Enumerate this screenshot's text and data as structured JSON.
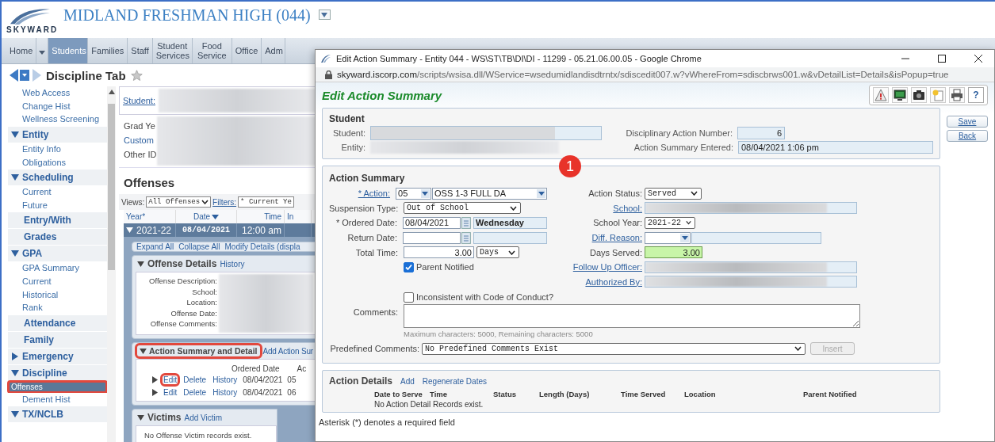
{
  "app": {
    "logo": "SKYWARD",
    "school": "MIDLAND FRESHMAN HIGH (044)"
  },
  "nav": [
    {
      "label": "Home",
      "selected": false,
      "menu": true
    },
    {
      "label": "Students",
      "selected": true,
      "menu": false
    },
    {
      "label": "Families",
      "selected": false,
      "menu": false
    },
    {
      "label": "Staff",
      "selected": false,
      "menu": false
    },
    {
      "label": "Student Services",
      "selected": false,
      "menu": false
    },
    {
      "label": "Food Service",
      "selected": false,
      "menu": false
    },
    {
      "label": "Office",
      "selected": false,
      "menu": false
    },
    {
      "label": "Adm",
      "selected": false,
      "menu": false
    }
  ],
  "breadcrumb": {
    "title": "Discipline Tab"
  },
  "sidebar": [
    {
      "kind": "link",
      "label": "Web Access",
      "selected": false,
      "highlighted": false
    },
    {
      "kind": "link",
      "label": "Change Hist",
      "selected": false,
      "highlighted": false
    },
    {
      "kind": "link",
      "label": "Wellness Screening",
      "selected": false,
      "highlighted": false
    },
    {
      "kind": "section",
      "label": "Entity",
      "expanded": true,
      "children": [
        {
          "kind": "link",
          "label": "Entity Info",
          "selected": false,
          "highlighted": false
        },
        {
          "kind": "link",
          "label": "Obligations",
          "selected": false,
          "highlighted": false
        }
      ]
    },
    {
      "kind": "section",
      "label": "Scheduling",
      "expanded": true,
      "children": [
        {
          "kind": "link",
          "label": "Current",
          "selected": false,
          "highlighted": false
        },
        {
          "kind": "link",
          "label": "Future",
          "selected": false,
          "highlighted": false
        }
      ]
    },
    {
      "kind": "heading",
      "label": "Entry/With"
    },
    {
      "kind": "heading",
      "label": "Grades"
    },
    {
      "kind": "section",
      "label": "GPA",
      "expanded": true,
      "children": [
        {
          "kind": "link",
          "label": "GPA Summary",
          "selected": false,
          "highlighted": false
        },
        {
          "kind": "link",
          "label": "Current",
          "selected": false,
          "highlighted": false
        },
        {
          "kind": "link",
          "label": "Historical",
          "selected": false,
          "highlighted": false
        },
        {
          "kind": "link",
          "label": "Rank",
          "selected": false,
          "highlighted": false
        }
      ]
    },
    {
      "kind": "heading",
      "label": "Attendance"
    },
    {
      "kind": "heading",
      "label": "Family"
    },
    {
      "kind": "section",
      "label": "Emergency",
      "expanded": false
    },
    {
      "kind": "section",
      "label": "Discipline",
      "expanded": true,
      "children": [
        {
          "kind": "link",
          "label": "Offenses",
          "selected": true,
          "highlighted": true
        },
        {
          "kind": "link",
          "label": "Dement Hist",
          "selected": false,
          "highlighted": false
        }
      ]
    },
    {
      "kind": "section",
      "label": "TX/NCLB",
      "expanded": true
    }
  ],
  "student_header": {
    "student_label": "Student:",
    "labels": [
      {
        "text": "Grad Ye",
        "link": false
      },
      {
        "text": "Custom",
        "link": true
      },
      {
        "text": "Other ID",
        "link": false
      }
    ]
  },
  "offenses": {
    "title": "Offenses",
    "views_label": "Views:",
    "view": "All Offenses",
    "filters_label": "Filters:",
    "filter": "* Current Ye",
    "columns": [
      {
        "label": "Year*",
        "sort": false
      },
      {
        "label": "Date",
        "sort": true
      },
      {
        "label": "Time",
        "sort": false
      },
      {
        "label": "In",
        "sort": false
      }
    ],
    "row": {
      "year": "2021-22",
      "date": "08/04/2021",
      "time": "12:00 am",
      "expanded": true
    },
    "toolbar": [
      "Expand All",
      "Collapse All",
      "Modify Details (displa"
    ],
    "details": {
      "title": "Offense Details",
      "link": "History",
      "expanded": true,
      "labels": [
        "Offense Description:",
        "School:",
        "Location:",
        "Offense Date:",
        "Offense Comments:"
      ]
    },
    "actions": {
      "title": "Action Summary and Detail",
      "link": "Add Action Sur",
      "highlighted": true,
      "expanded": true,
      "columns": [
        "Ordered Date",
        "Ac"
      ],
      "rows": [
        {
          "links": [
            "Edit",
            "Delete",
            "History"
          ],
          "date": "08/04/2021",
          "action": "05",
          "highlighted": true
        },
        {
          "links": [
            "Edit",
            "Delete",
            "History"
          ],
          "date": "08/04/2021",
          "action": "06",
          "highlighted": false
        }
      ]
    },
    "victims": {
      "title": "Victims",
      "link": "Add Victim",
      "expanded": true,
      "message": "No Offense Victim records exist."
    }
  },
  "popup": {
    "window_title": "Edit Action Summary - Entity 044 - WS\\ST\\TB\\DI\\DI - 11299 - 05.21.06.00.05 - Google Chrome",
    "url_host": "skyward.iscorp.com",
    "url_path": "/scripts/wsisa.dll/WService=wsedumidlandisdtrntx/sdiscedit007.w?vWhereFrom=sdiscbrws001.w&vDetailList=Details&isPopup=true",
    "heading": "Edit Action Summary",
    "help": "?",
    "buttons": [
      "Save",
      "Back"
    ],
    "student": {
      "title": "Student",
      "fields": [
        "Student:",
        "Entity:"
      ],
      "info": [
        {
          "label": "Disciplinary Action Number:",
          "value": "6"
        },
        {
          "label": "Action Summary Entered:",
          "value": "08/04/2021 1:06 pm"
        }
      ]
    },
    "callout": "1",
    "summary": {
      "title": "Action Summary",
      "left": [
        {
          "kind": "code-select",
          "label": "* Action:",
          "link": true,
          "code": "05",
          "value": "OSS 1-3 FULL DA"
        },
        {
          "kind": "select",
          "label": "Suspension Type:",
          "link": false,
          "value": "Out of School"
        },
        {
          "kind": "date",
          "label": "* Ordered Date:",
          "link": false,
          "value": "08/04/2021",
          "day": "Wednesday"
        },
        {
          "kind": "date",
          "label": "Return Date:",
          "link": false
        },
        {
          "kind": "number-unit",
          "label": "Total Time:",
          "link": false,
          "value": "3.00",
          "unit": "Days"
        },
        {
          "kind": "checkbox",
          "label": "Parent Notified",
          "checked": true
        }
      ],
      "right": [
        {
          "kind": "select",
          "label": "Action Status:",
          "link": false,
          "value": "Served"
        },
        {
          "kind": "redacted",
          "label": "School:",
          "link": true
        },
        {
          "kind": "select",
          "label": "School Year:",
          "link": false,
          "value": "2021-22"
        },
        {
          "kind": "code-select",
          "label": "Diff. Reason:",
          "link": true
        },
        {
          "kind": "number",
          "label": "Days Served:",
          "link": false,
          "value": "3.00",
          "highlighted": true
        },
        {
          "kind": "redacted",
          "label": "Follow Up Officer:",
          "link": true
        },
        {
          "kind": "redacted",
          "label": "Authorized By:",
          "link": true
        }
      ],
      "inconsistent": {
        "label": "Inconsistent with Code of Conduct?",
        "checked": false
      },
      "comments_label": "Comments:",
      "comments_note": "Maximum characters: 5000, Remaining characters: 5000",
      "predefined_label": "Predefined Comments:",
      "predefined": "No Predefined Comments Exist",
      "insert": {
        "label": "Insert",
        "disabled": true
      }
    },
    "details": {
      "title": "Action Details",
      "links": [
        "Add",
        "Regenerate Dates"
      ],
      "columns": [
        "Date to Serve",
        "Time",
        "Status",
        "Length (Days)",
        "Time Served",
        "Location",
        "Parent Notified"
      ],
      "message": "No Action Detail Records exist."
    },
    "footer": "Asterisk (*) denotes a required field"
  }
}
